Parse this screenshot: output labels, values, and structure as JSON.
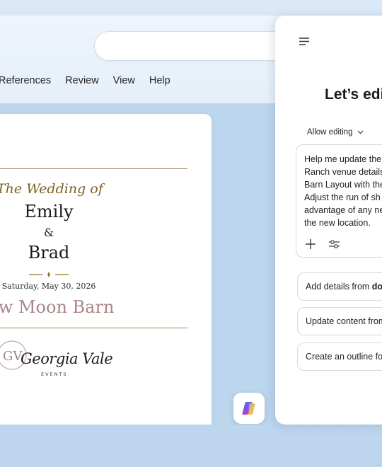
{
  "ribbon": {
    "tabs": [
      "References",
      "Review",
      "View",
      "Help"
    ]
  },
  "document": {
    "title_line": "The Wedding of",
    "name_one": "Emily",
    "ampersand": "&",
    "name_two": "Brad",
    "date": "Saturday, May 30, 2026",
    "venue": "dow Moon Barn",
    "logo": {
      "monogram": "GV",
      "script": "Georgia Vale",
      "tagline": "EVENTS"
    }
  },
  "copilot_button": {
    "icon": "copilot-icon"
  },
  "panel": {
    "menu_icon": "hamburger-menu-icon",
    "title": "Let’s edi",
    "allow_editing": "Allow editing",
    "prompt_lines": [
      "Help me update the",
      "Ranch venue details",
      "Barn Layout with the",
      "Adjust the run of sh",
      "advantage of any ne",
      "the new location."
    ],
    "tools": [
      "plus-icon",
      "settings-sliders-icon"
    ],
    "suggestions": [
      {
        "prefix": "Add details from ",
        "bold": "doc"
      },
      {
        "prefix": "Update content from",
        "bold": ""
      },
      {
        "prefix": "Create an outline fo",
        "bold": ""
      }
    ]
  },
  "colors": {
    "background": "#c7dcf1",
    "gold": "#7d6220",
    "venue_mauve": "#a9868a",
    "rule_gold": "#a08a4d"
  }
}
